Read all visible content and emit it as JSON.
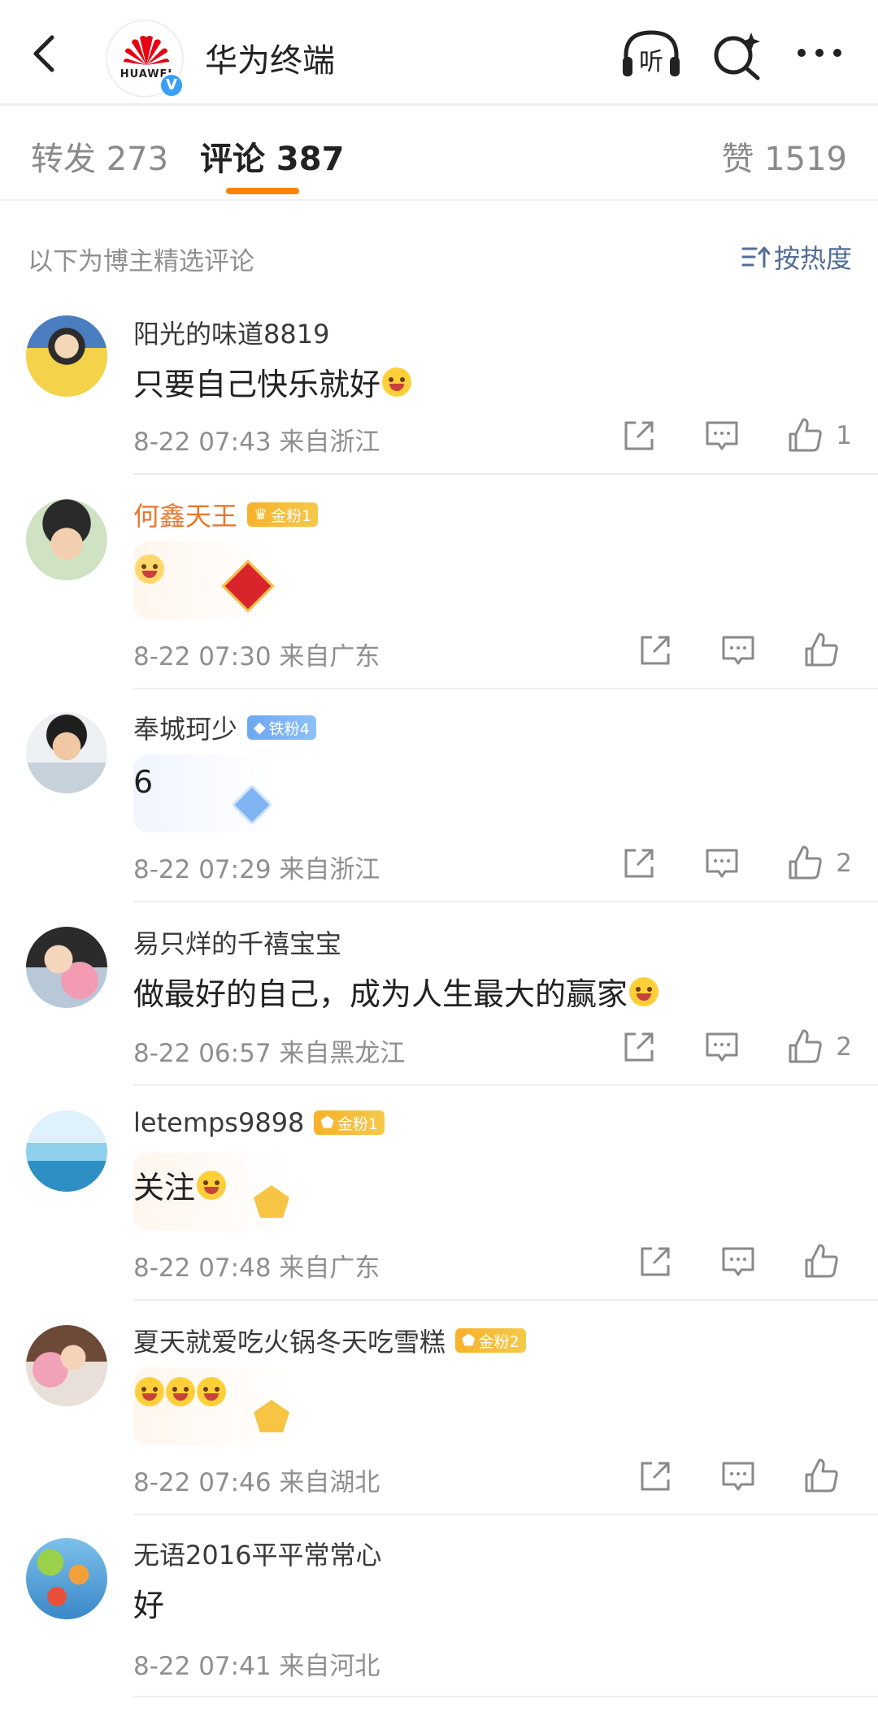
{
  "header": {
    "account_name": "华为终端",
    "logo_text": "HUAWEI",
    "verified_mark": "V",
    "icons": [
      "back-arrow-icon",
      "listen-icon",
      "search-icon",
      "more-icon"
    ],
    "listen_label": "听"
  },
  "tabs": [
    {
      "label": "转发 273"
    },
    {
      "label": "评论 387"
    },
    {
      "label": "赞 1519"
    }
  ],
  "filter": {
    "note": "以下为博主精选评论",
    "sort_label": "按热度"
  },
  "colors": {
    "accent": "#ff8200",
    "gold_name": "#e8762b",
    "link_blue": "#526d96",
    "meta_gray": "#8f8f8f"
  },
  "comments": [
    {
      "name": "阳光的味道8819",
      "text": "只要自己快乐就好",
      "emoji": "grin-emoji",
      "time": "8-22 07:43",
      "location": "来自浙江",
      "likes": "1",
      "badge": ""
    },
    {
      "name": "何鑫天王",
      "text": "",
      "emoji": "cute-emoji",
      "time": "8-22 07:30",
      "location": "来自广东",
      "likes": "",
      "badge": "金粉1"
    },
    {
      "name": "奉城珂少",
      "text": "6",
      "emoji": "",
      "time": "8-22 07:29",
      "location": "来自浙江",
      "likes": "2",
      "badge": "铁粉4"
    },
    {
      "name": "易只烊的千禧宝宝",
      "text": "做最好的自己，成为人生最大的赢家",
      "emoji": "tears-emoji",
      "time": "8-22 06:57",
      "location": "来自黑龙江",
      "likes": "2",
      "badge": ""
    },
    {
      "name": "letemps9898",
      "text": "关注",
      "emoji": "tears-emoji",
      "time": "8-22 07:48",
      "location": "来自广东",
      "likes": "",
      "badge": "金粉1"
    },
    {
      "name": "夏天就爱吃火锅冬天吃雪糕",
      "text": "",
      "emoji": "tears-emoji-x3",
      "time": "8-22 07:46",
      "location": "来自湖北",
      "likes": "",
      "badge": "金粉2"
    },
    {
      "name": "无语2016平平常常心",
      "text": "好",
      "emoji": "",
      "time": "8-22 07:41",
      "location": "来自河北",
      "likes": "",
      "badge": ""
    }
  ]
}
